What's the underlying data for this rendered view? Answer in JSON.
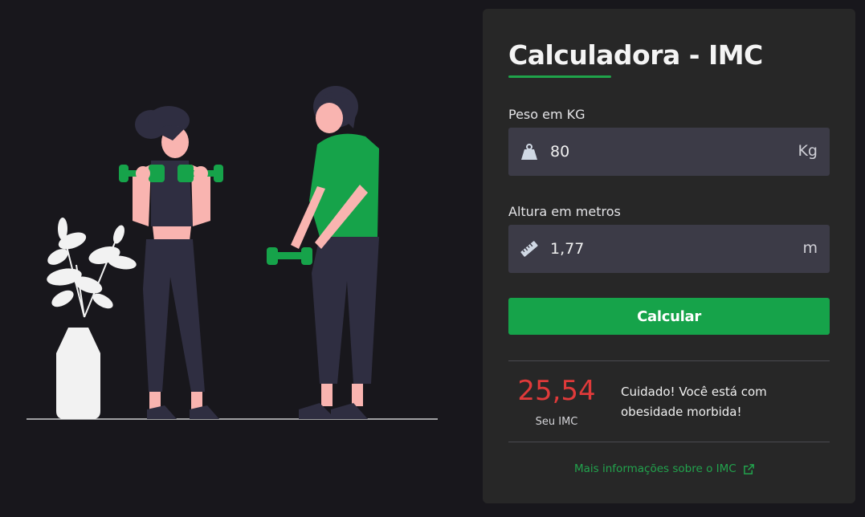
{
  "calculator": {
    "title": "Calculadora - IMC",
    "weight": {
      "label": "Peso em KG",
      "value": "80",
      "unit": "Kg",
      "icon": "weight-icon"
    },
    "height": {
      "label": "Altura em metros",
      "value": "1,77",
      "unit": "m",
      "icon": "ruler-icon"
    },
    "submit_label": "Calcular",
    "result": {
      "value": "25,54",
      "caption": "Seu IMC",
      "message": "Cuidado! Você está com obesidade morbida!"
    },
    "more_info_label": "Mais informações sobre o IMC",
    "more_info_icon": "external-link-icon"
  },
  "colors": {
    "background": "#18171c",
    "card": "#272727",
    "accent": "#16a34a",
    "input_bg": "#3c3b47",
    "result_value": "#e03a3a"
  }
}
